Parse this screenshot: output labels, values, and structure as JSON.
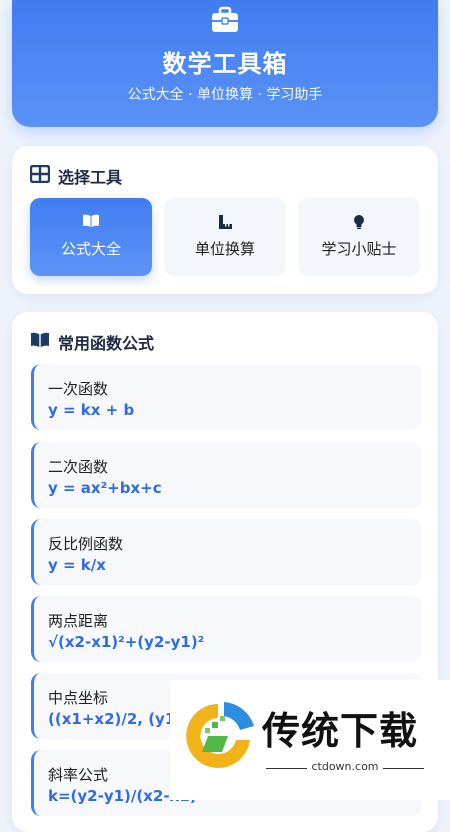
{
  "header": {
    "title": "数学工具箱",
    "subtitle": "公式大全 · 单位换算 · 学习助手",
    "icon": "toolbox-icon"
  },
  "tools_section": {
    "title": "选择工具",
    "icon": "grid-icon",
    "tabs": [
      {
        "label": "公式大全",
        "icon": "book-icon",
        "active": true
      },
      {
        "label": "单位换算",
        "icon": "ruler-icon",
        "active": false
      },
      {
        "label": "学习小贴士",
        "icon": "lightbulb-icon",
        "active": false
      }
    ]
  },
  "formulas_section": {
    "title": "常用函数公式",
    "icon": "book-icon",
    "items": [
      {
        "name": "一次函数",
        "expr": "y = kx + b"
      },
      {
        "name": "二次函数",
        "expr": "y = ax²+bx+c"
      },
      {
        "name": "反比例函数",
        "expr": "y = k/x"
      },
      {
        "name": "两点距离",
        "expr": "√(x2-x1)²+(y2-y1)²"
      },
      {
        "name": "中点坐标",
        "expr": "((x1+x2)/2, (y1+y2)/2)"
      },
      {
        "name": "斜率公式",
        "expr": "k=(y2-y1)/(x2-x1)"
      }
    ]
  },
  "watermark": {
    "text": "传统下载",
    "url": "ctdown.com"
  },
  "colors": {
    "accent": "#3f7df1",
    "formula_text": "#2f6be8",
    "background": "#eef3fb"
  }
}
